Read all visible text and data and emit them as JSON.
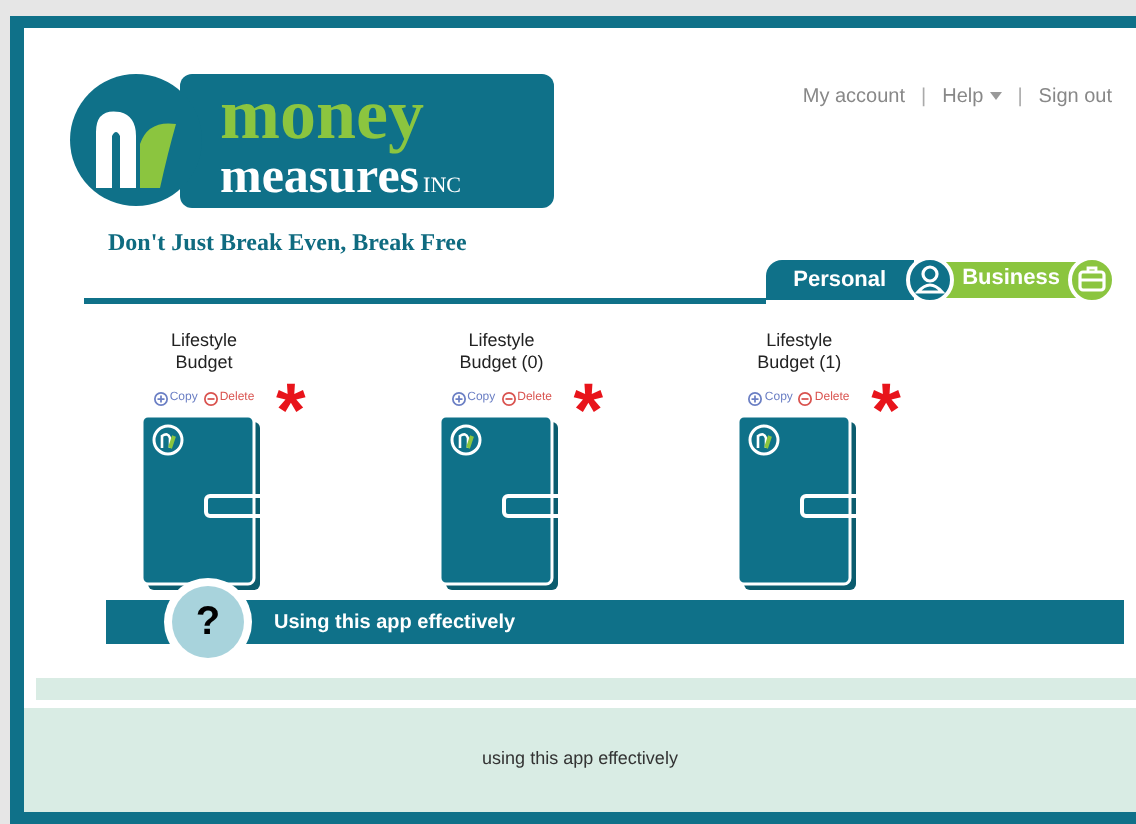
{
  "logo": {
    "word_top": "money",
    "word_bottom": "measures",
    "suffix": "INC",
    "tagline": "Don't Just Break Even, Break Free"
  },
  "nav": [
    {
      "label": "My account",
      "kind": "link"
    },
    {
      "label": "Help",
      "kind": "dropdown"
    },
    {
      "label": "Sign out",
      "kind": "link"
    }
  ],
  "nav_separator": "|",
  "tabs": [
    {
      "label": "Personal",
      "kind": "person",
      "selected": true
    },
    {
      "label": "Business",
      "kind": "briefcase",
      "selected": false
    }
  ],
  "budgets": [
    {
      "title": "Lifestyle Budget",
      "copy": "Copy",
      "delete": "Delete",
      "marker": "*"
    },
    {
      "title": "Lifestyle Budget (0)",
      "copy": "Copy",
      "delete": "Delete",
      "marker": "*"
    },
    {
      "title": "Lifestyle Budget (1)",
      "copy": "Copy",
      "delete": "Delete",
      "marker": "*"
    }
  ],
  "help_bar": {
    "icon": "?",
    "label": "Using this app effectively"
  },
  "footer": {
    "text": "using this app effectively"
  }
}
